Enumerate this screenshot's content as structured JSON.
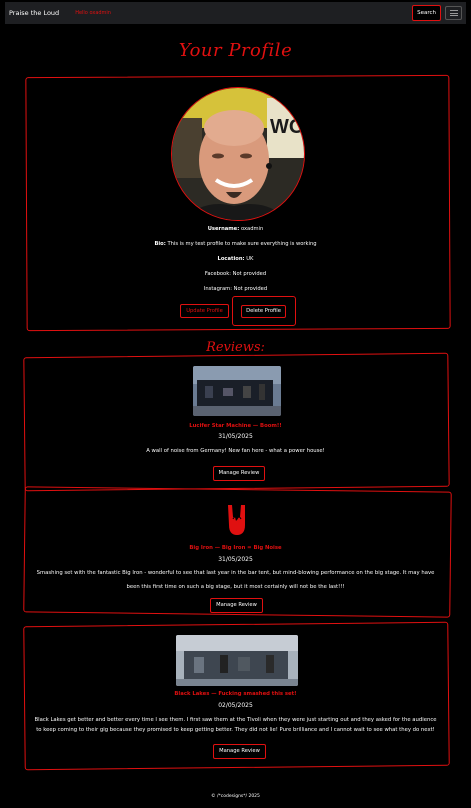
{
  "navbar": {
    "brand": "Praise the Loud",
    "welcome": "Hello oxadmin",
    "search_label": "Search",
    "menu_icon": "hamburger-icon"
  },
  "profile": {
    "title": "Your Profile",
    "username_label": "Username:",
    "username": "oxadmin",
    "bio_label": "Bio:",
    "bio": "This is my test profile to make sure everything is working",
    "location_label": "Location:",
    "location": "UK",
    "facebook": "Facebook: Not provided",
    "instagram": "Instagram: Not provided",
    "update_label": "Update Profile",
    "delete_label": "Delete Profile"
  },
  "reviews_title": "Reviews:",
  "reviews": [
    {
      "title": "Lucifer Star Machine — Boom!!",
      "date": "31/05/2025",
      "body": "A wall of noise from Germany! New fan here - what a power house!",
      "manage_label": "Manage Review",
      "image_icon": "concert-photo"
    },
    {
      "title": "Big Iron — Big Iron = Big Noise",
      "date": "31/05/2025",
      "body_line1": "Smashing set with the fantastic Big Iron - wonderful to see that last year in the bar tent, but mind-blowing performance on the big stage. It may have",
      "body_line2": "been this first time on such a big stage, but it most certainly will not be the last!!!",
      "manage_label": "Manage Review",
      "image_icon": "rock-horns-icon"
    },
    {
      "title": "Black Lakes — Fucking smashed this set!",
      "date": "02/05/2025",
      "body_line1": "Black Lakes get better and better every time I see them. I first saw them at the Tivoli when they were just starting out and they asked for the audience",
      "body_line2": "to keep coming to their gig because they promised to keep getting better. They did not lie! Pure brilliance and I cannot wait to see what they do next!",
      "manage_label": "Manage Review",
      "image_icon": "concert-photo"
    }
  ],
  "footer": "© /*codesigns*/ 2025",
  "colors": {
    "accent": "#e01010",
    "background": "#000000",
    "navbar": "#1e1f22"
  }
}
